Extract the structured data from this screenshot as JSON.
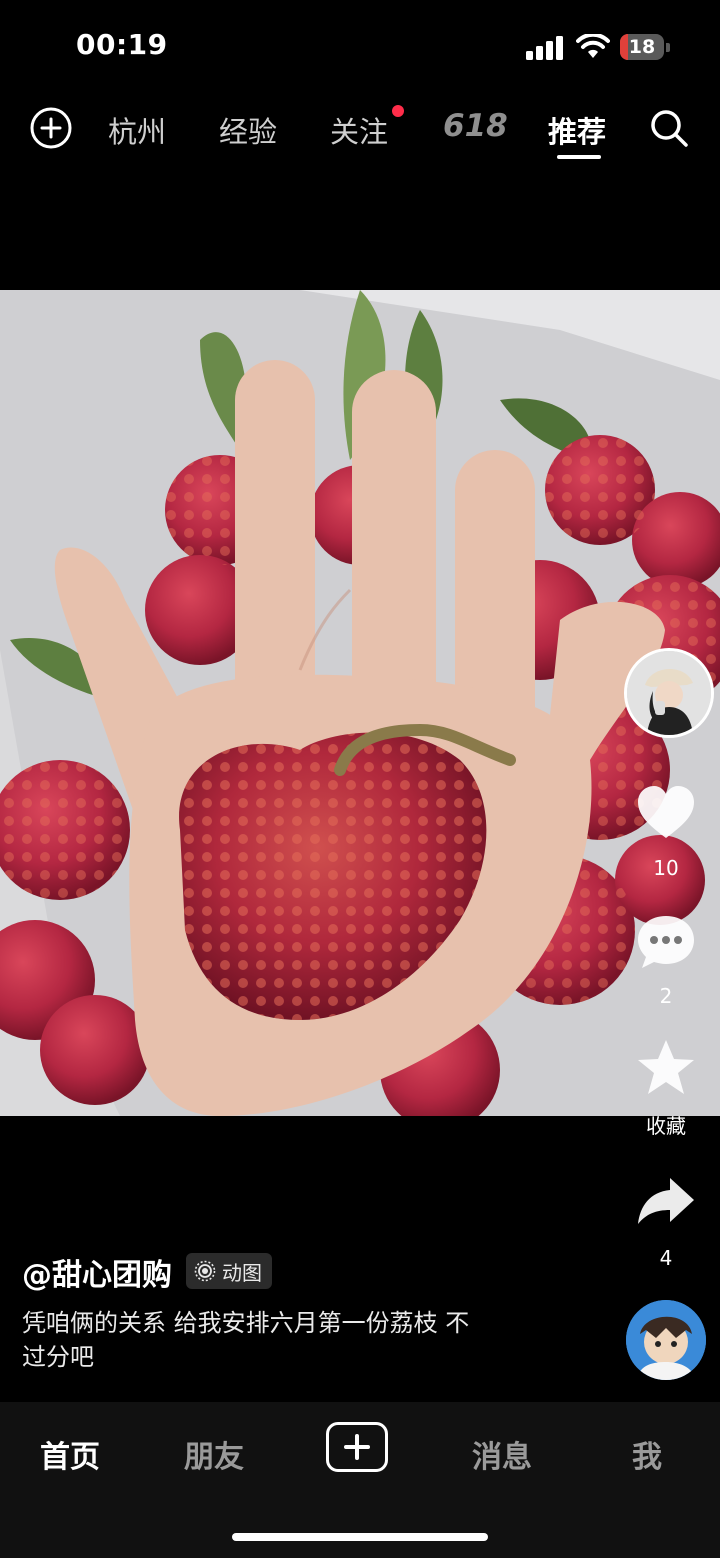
{
  "status_bar": {
    "time": "00:19",
    "battery_level": "18"
  },
  "top_nav": {
    "tabs": [
      {
        "label": "杭州",
        "active": false
      },
      {
        "label": "经验",
        "active": false
      },
      {
        "label": "关注",
        "active": false,
        "has_dot": true
      },
      {
        "label": "618",
        "active": false
      },
      {
        "label": "推荐",
        "active": true
      }
    ],
    "add_icon": "plus-circle-icon",
    "search_icon": "search-icon"
  },
  "post": {
    "username": "@甜心团购",
    "badge": "动图",
    "caption_line1": "凭咱俩的关系 给我安排六月第一份荔枝 不",
    "caption_line2": "过分吧",
    "likes": "10",
    "comments": "2",
    "favorite_label": "收藏",
    "shares": "4"
  },
  "bottom_nav": {
    "home": "首页",
    "friends": "朋友",
    "messages": "消息",
    "me": "我"
  },
  "colors": {
    "accent_red": "#ff2d4a",
    "background": "#000000"
  }
}
